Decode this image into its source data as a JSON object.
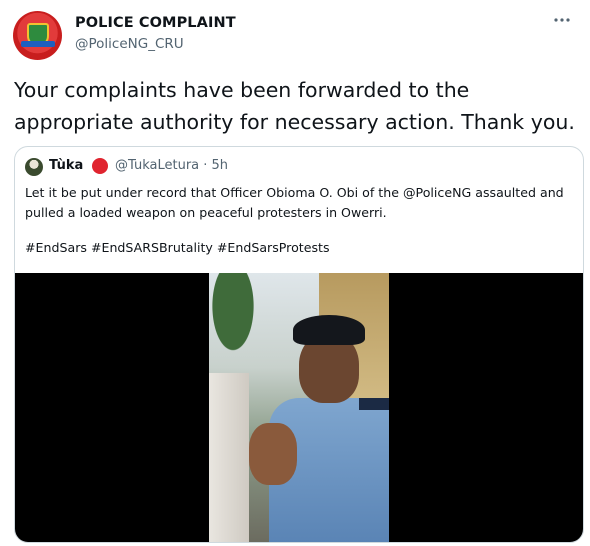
{
  "author": {
    "display_name": "POLICE COMPLAINT",
    "handle": "@PoliceNG_CRU",
    "avatar_icon": "police-badge-avatar"
  },
  "menu_icon": "more-options-icon",
  "tweet": {
    "text": "Your complaints have been forwarded to the appropriate authority for necessary action. Thank you."
  },
  "quoted_tweet": {
    "display_name": "Tùka",
    "handle_time": "@TukaLetura · 5h",
    "text": "Let it be put under record that Officer Obioma O. Obi of the @PoliceNG assaulted and pulled a loaded weapon on peaceful protesters in Owerri.",
    "hashtags": "#EndSars #EndSARSBrutality #EndSarsProtests",
    "media_type": "video-thumbnail"
  }
}
